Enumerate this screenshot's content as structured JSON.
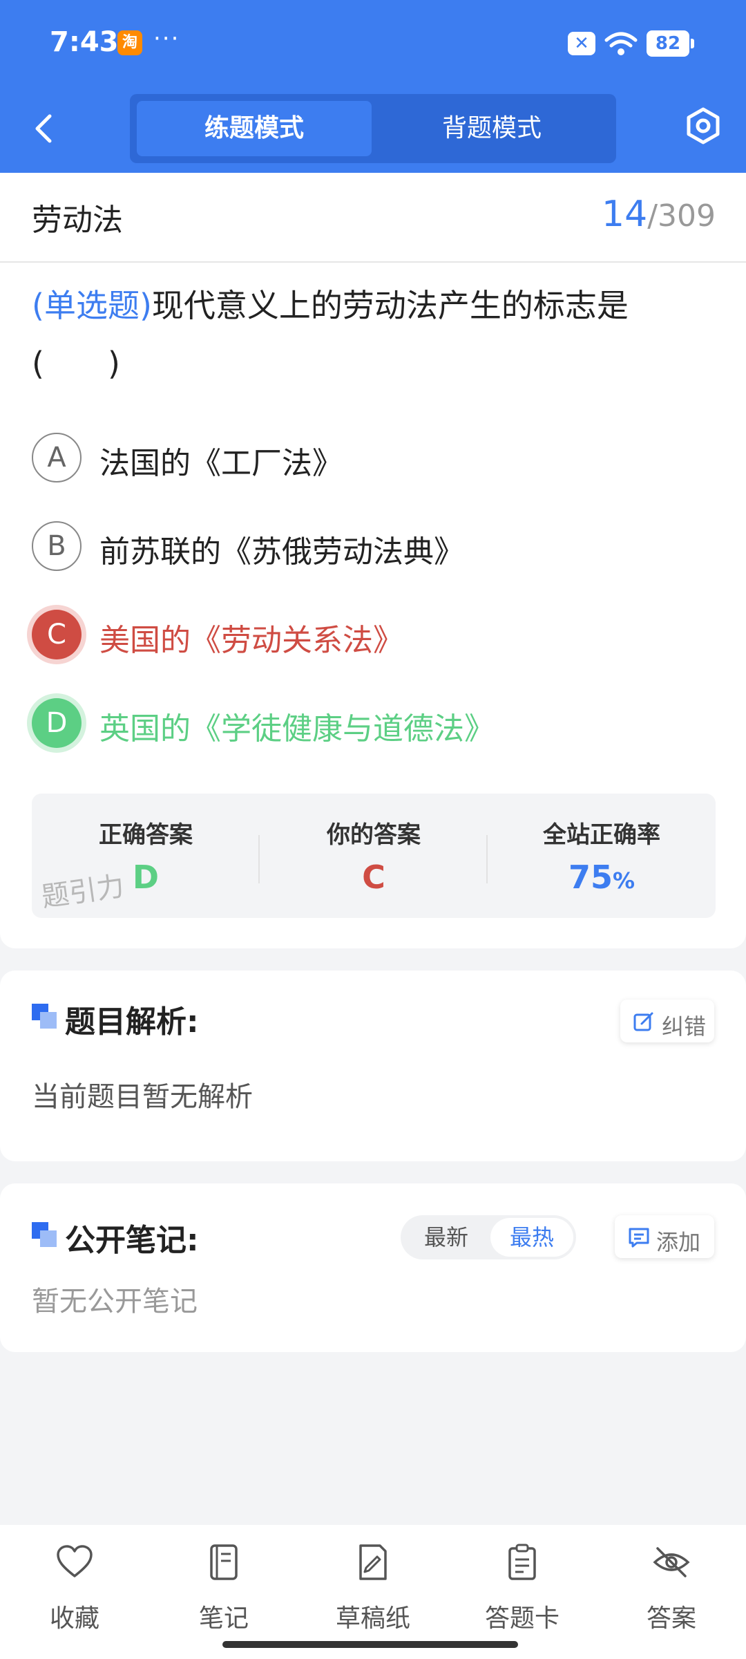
{
  "status_bar": {
    "time": "7:43",
    "taobao_icon": "淘",
    "dots": "···",
    "battery": "82"
  },
  "header": {
    "modes": [
      {
        "label": "练题模式",
        "active": true
      },
      {
        "label": "背题模式",
        "active": false
      }
    ],
    "accent_color": "#3d7df0"
  },
  "question": {
    "subject": "劳动法",
    "current": "14",
    "separator": "/",
    "total": "309",
    "type": "(单选题)",
    "text": "现代意义上的劳动法产生的标志是(　　)",
    "options": [
      {
        "letter": "A",
        "text": "法国的《工厂法》",
        "state": "normal"
      },
      {
        "letter": "B",
        "text": "前苏联的《苏俄劳动法典》",
        "state": "normal"
      },
      {
        "letter": "C",
        "text": "美国的《劳动关系法》",
        "state": "wrong"
      },
      {
        "letter": "D",
        "text": "英国的《学徒健康与道德法》",
        "state": "right"
      }
    ]
  },
  "result": {
    "correct_label": "正确答案",
    "correct_value": "D",
    "yours_label": "你的答案",
    "yours_value": "C",
    "rate_label": "全站正确率",
    "rate_value": "75",
    "rate_unit": "%",
    "watermark": "题引力"
  },
  "analysis": {
    "title": "题目解析:",
    "report_label": "纠错",
    "body": "当前题目暂无解析"
  },
  "notes": {
    "title": "公开笔记:",
    "sort_options": [
      "最新",
      "最热"
    ],
    "selected_sort": "最热",
    "add_label": "添加",
    "body": "暂无公开笔记"
  },
  "bottom_bar": [
    {
      "label": "收藏",
      "icon": "heart-icon"
    },
    {
      "label": "笔记",
      "icon": "notebook-icon"
    },
    {
      "label": "草稿纸",
      "icon": "draft-paper-icon"
    },
    {
      "label": "答题卡",
      "icon": "answer-sheet-icon"
    },
    {
      "label": "答案",
      "icon": "eye-off-icon"
    }
  ],
  "colors": {
    "wrong": "#cf4c43",
    "right": "#5ccf84"
  }
}
